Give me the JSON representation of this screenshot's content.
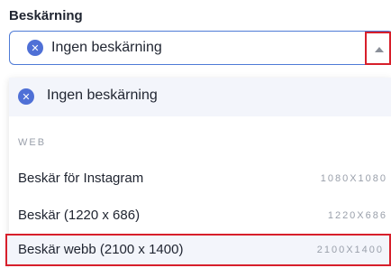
{
  "field": {
    "label": "Beskärning"
  },
  "select": {
    "value": "Ingen beskärning",
    "clear_icon": "close-circle-icon",
    "arrow_icon": "caret-up-icon"
  },
  "menu": {
    "clear_option": "Ingen beskärning",
    "group_label": "WEB",
    "options": [
      {
        "label": "Beskär för Instagram",
        "size": "1080X1080"
      },
      {
        "label": "Beskär (1220 x 686)",
        "size": "1220X686"
      },
      {
        "label": "Beskär webb (2100 x 1400)",
        "size": "2100X1400"
      }
    ]
  },
  "colors": {
    "accent": "#4f70d6",
    "highlight_border": "#d71f2b"
  }
}
